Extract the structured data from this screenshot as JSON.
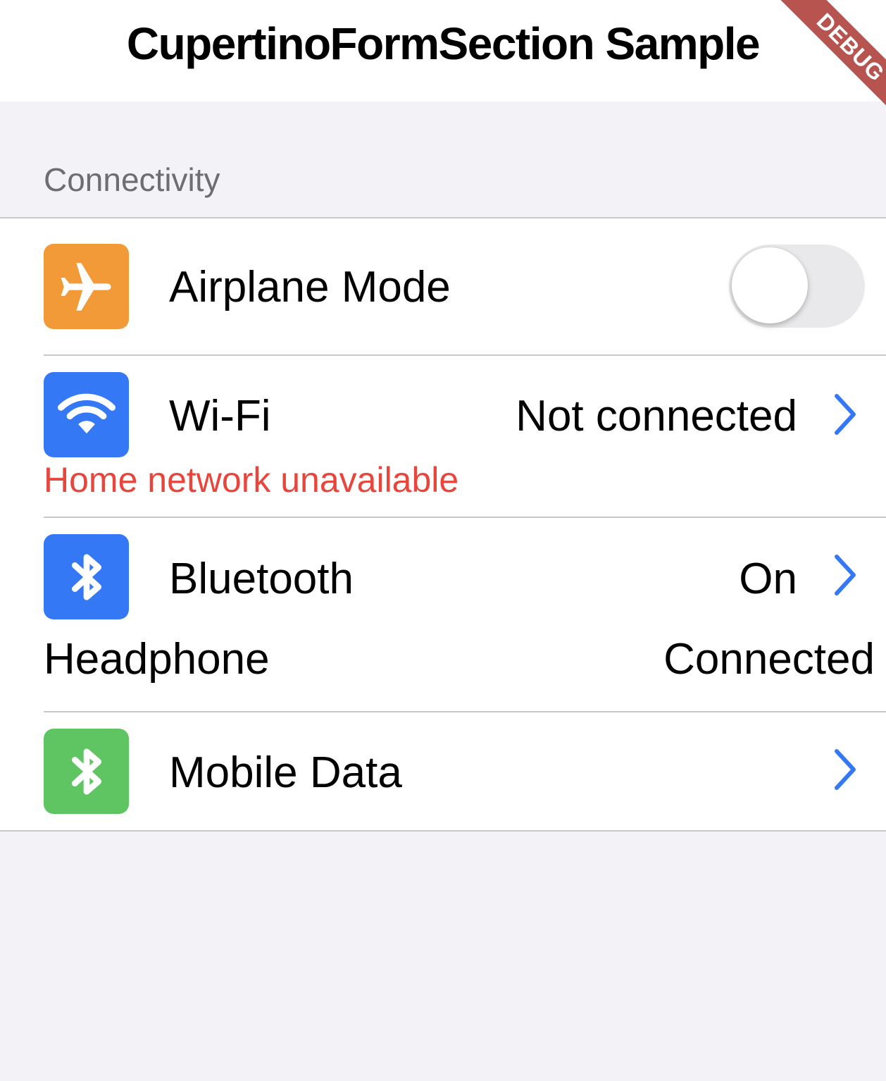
{
  "navbar": {
    "title": "CupertinoFormSection Sample",
    "debug_label": "DEBUG"
  },
  "section": {
    "header": "Connectivity",
    "rows": [
      {
        "label": "Airplane Mode",
        "icon": "airplane-icon",
        "icon_color": "#f19a37",
        "switch_on": false
      },
      {
        "label": "Wi-Fi",
        "icon": "wifi-icon",
        "icon_color": "#3478f6",
        "value": "Not connected",
        "error": "Home network unavailable"
      },
      {
        "label": "Bluetooth",
        "icon": "bluetooth-icon",
        "icon_color": "#3478f6",
        "value": "On",
        "subtitle_label": "Headphone",
        "subtitle_value": "Connected"
      },
      {
        "label": "Mobile Data",
        "icon": "bluetooth-icon",
        "icon_color": "#5fc563"
      }
    ]
  },
  "colors": {
    "accent": "#3478f6",
    "error": "#e8453c",
    "background": "#f2f2f7",
    "divider": "#c8c7cc"
  }
}
